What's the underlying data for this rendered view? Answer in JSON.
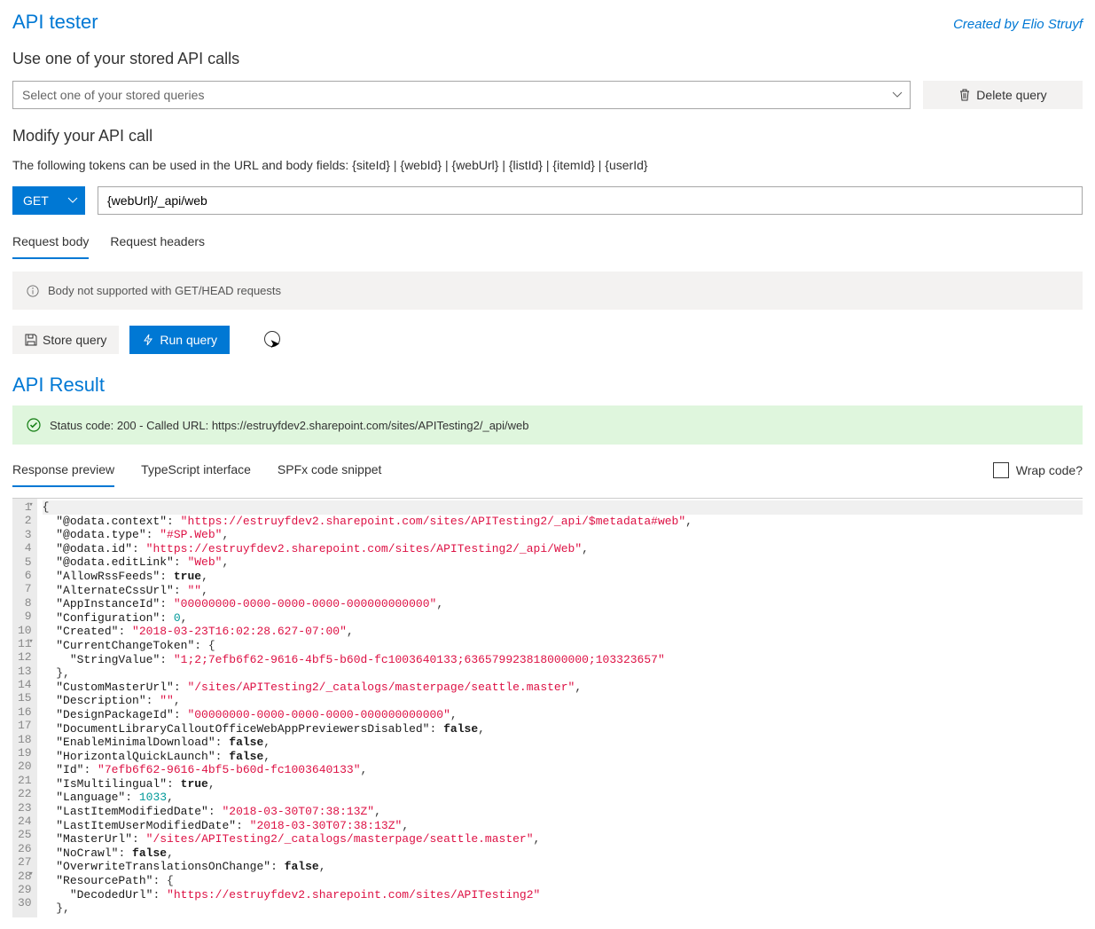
{
  "header": {
    "title": "API tester",
    "credit": "Created by Elio Struyf"
  },
  "stored": {
    "heading": "Use one of your stored API calls",
    "placeholder": "Select one of your stored queries",
    "delete_label": "Delete query"
  },
  "modify": {
    "heading": "Modify your API call",
    "tokens_note": "The following tokens can be used in the URL and body fields: {siteId} | {webId} | {webUrl} | {listId} | {itemId} | {userId}",
    "method": "GET",
    "url": "{webUrl}/_api/web",
    "tabs": {
      "body": "Request body",
      "headers": "Request headers"
    },
    "body_unsupported": "Body not supported with GET/HEAD requests",
    "store_label": "Store query",
    "run_label": "Run query"
  },
  "result": {
    "heading": "API Result",
    "status_text": "Status code: 200 - Called URL: https://estruyfdev2.sharepoint.com/sites/APITesting2/_api/web",
    "tabs": {
      "preview": "Response preview",
      "ts": "TypeScript interface",
      "spfx": "SPFx code snippet"
    },
    "wrap_label": "Wrap code?"
  },
  "code": {
    "lines": [
      {
        "n": 1,
        "indent": 0,
        "fold": true,
        "pre": "",
        "text": "{"
      },
      {
        "n": 2,
        "indent": 1,
        "pre": "\"@odata.context\"",
        "post": ": ",
        "val": "\"https://estruyfdev2.sharepoint.com/sites/APITesting2/_api/$metadata#web\"",
        "t": "str",
        "comma": true
      },
      {
        "n": 3,
        "indent": 1,
        "pre": "\"@odata.type\"",
        "post": ": ",
        "val": "\"#SP.Web\"",
        "t": "str",
        "comma": true
      },
      {
        "n": 4,
        "indent": 1,
        "pre": "\"@odata.id\"",
        "post": ": ",
        "val": "\"https://estruyfdev2.sharepoint.com/sites/APITesting2/_api/Web\"",
        "t": "str",
        "comma": true
      },
      {
        "n": 5,
        "indent": 1,
        "pre": "\"@odata.editLink\"",
        "post": ": ",
        "val": "\"Web\"",
        "t": "str",
        "comma": true
      },
      {
        "n": 6,
        "indent": 1,
        "pre": "\"AllowRssFeeds\"",
        "post": ": ",
        "val": "true",
        "t": "bool",
        "comma": true
      },
      {
        "n": 7,
        "indent": 1,
        "pre": "\"AlternateCssUrl\"",
        "post": ": ",
        "val": "\"\"",
        "t": "str",
        "comma": true
      },
      {
        "n": 8,
        "indent": 1,
        "pre": "\"AppInstanceId\"",
        "post": ": ",
        "val": "\"00000000-0000-0000-0000-000000000000\"",
        "t": "str",
        "comma": true
      },
      {
        "n": 9,
        "indent": 1,
        "pre": "\"Configuration\"",
        "post": ": ",
        "val": "0",
        "t": "num",
        "comma": true
      },
      {
        "n": 10,
        "indent": 1,
        "pre": "\"Created\"",
        "post": ": ",
        "val": "\"2018-03-23T16:02:28.627-07:00\"",
        "t": "str",
        "comma": true
      },
      {
        "n": 11,
        "indent": 1,
        "fold": true,
        "pre": "\"CurrentChangeToken\"",
        "post": ": ",
        "text": "{"
      },
      {
        "n": 12,
        "indent": 2,
        "pre": "\"StringValue\"",
        "post": ": ",
        "val": "\"1;2;7efb6f62-9616-4bf5-b60d-fc1003640133;636579923818000000;103323657\"",
        "t": "str"
      },
      {
        "n": 13,
        "indent": 1,
        "text": "},",
        "plain": true
      },
      {
        "n": 14,
        "indent": 1,
        "pre": "\"CustomMasterUrl\"",
        "post": ": ",
        "val": "\"/sites/APITesting2/_catalogs/masterpage/seattle.master\"",
        "t": "str",
        "comma": true
      },
      {
        "n": 15,
        "indent": 1,
        "pre": "\"Description\"",
        "post": ": ",
        "val": "\"\"",
        "t": "str",
        "comma": true
      },
      {
        "n": 16,
        "indent": 1,
        "pre": "\"DesignPackageId\"",
        "post": ": ",
        "val": "\"00000000-0000-0000-0000-000000000000\"",
        "t": "str",
        "comma": true
      },
      {
        "n": 17,
        "indent": 1,
        "pre": "\"DocumentLibraryCalloutOfficeWebAppPreviewersDisabled\"",
        "post": ": ",
        "val": "false",
        "t": "bool",
        "comma": true
      },
      {
        "n": 18,
        "indent": 1,
        "pre": "\"EnableMinimalDownload\"",
        "post": ": ",
        "val": "false",
        "t": "bool",
        "comma": true
      },
      {
        "n": 19,
        "indent": 1,
        "pre": "\"HorizontalQuickLaunch\"",
        "post": ": ",
        "val": "false",
        "t": "bool",
        "comma": true
      },
      {
        "n": 20,
        "indent": 1,
        "pre": "\"Id\"",
        "post": ": ",
        "val": "\"7efb6f62-9616-4bf5-b60d-fc1003640133\"",
        "t": "str",
        "comma": true
      },
      {
        "n": 21,
        "indent": 1,
        "pre": "\"IsMultilingual\"",
        "post": ": ",
        "val": "true",
        "t": "bool",
        "comma": true
      },
      {
        "n": 22,
        "indent": 1,
        "pre": "\"Language\"",
        "post": ": ",
        "val": "1033",
        "t": "num",
        "comma": true
      },
      {
        "n": 23,
        "indent": 1,
        "pre": "\"LastItemModifiedDate\"",
        "post": ": ",
        "val": "\"2018-03-30T07:38:13Z\"",
        "t": "str",
        "comma": true
      },
      {
        "n": 24,
        "indent": 1,
        "pre": "\"LastItemUserModifiedDate\"",
        "post": ": ",
        "val": "\"2018-03-30T07:38:13Z\"",
        "t": "str",
        "comma": true
      },
      {
        "n": 25,
        "indent": 1,
        "pre": "\"MasterUrl\"",
        "post": ": ",
        "val": "\"/sites/APITesting2/_catalogs/masterpage/seattle.master\"",
        "t": "str",
        "comma": true
      },
      {
        "n": 26,
        "indent": 1,
        "pre": "\"NoCrawl\"",
        "post": ": ",
        "val": "false",
        "t": "bool",
        "comma": true
      },
      {
        "n": 27,
        "indent": 1,
        "pre": "\"OverwriteTranslationsOnChange\"",
        "post": ": ",
        "val": "false",
        "t": "bool",
        "comma": true
      },
      {
        "n": 28,
        "indent": 1,
        "fold": true,
        "pre": "\"ResourcePath\"",
        "post": ": ",
        "text": "{"
      },
      {
        "n": 29,
        "indent": 2,
        "pre": "\"DecodedUrl\"",
        "post": ": ",
        "val": "\"https://estruyfdev2.sharepoint.com/sites/APITesting2\"",
        "t": "str"
      },
      {
        "n": 30,
        "indent": 1,
        "text": "},",
        "plain": true
      }
    ]
  }
}
